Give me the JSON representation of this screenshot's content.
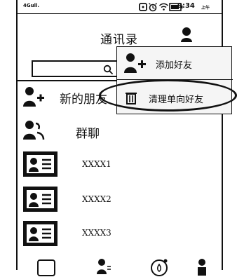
{
  "status_bar": {
    "signal_label": "4Gull.",
    "time": "9:34",
    "time_suffix": "上午"
  },
  "header": {
    "title": "通讯录"
  },
  "search": {
    "label": "搜"
  },
  "rows": [
    {
      "label": "新的朋友"
    },
    {
      "label": "群聊"
    }
  ],
  "contacts": [
    {
      "name": "XXXX1"
    },
    {
      "name": "XXXX2"
    },
    {
      "name": "XXXX3"
    }
  ],
  "menu": {
    "items": [
      {
        "label": "添加好友"
      },
      {
        "label": "清理单向好友"
      }
    ]
  },
  "colors": {
    "stroke": "#111111",
    "background": "#ffffff",
    "menu_background": "#f5f5f5"
  },
  "icons": {
    "add_friend": "add-friend-icon",
    "group_chat": "group-chat-icon",
    "contact_card": "contact-card-icon",
    "trash": "trash-icon",
    "profile": "profile-icon",
    "search": "search-icon",
    "battery": "battery-icon",
    "wifi": "wifi-icon",
    "alarm": "alarm-icon",
    "bottom_tabs": [
      "chat-tab-icon",
      "contacts-tab-icon",
      "discover-tab-icon",
      "me-tab-icon"
    ]
  }
}
